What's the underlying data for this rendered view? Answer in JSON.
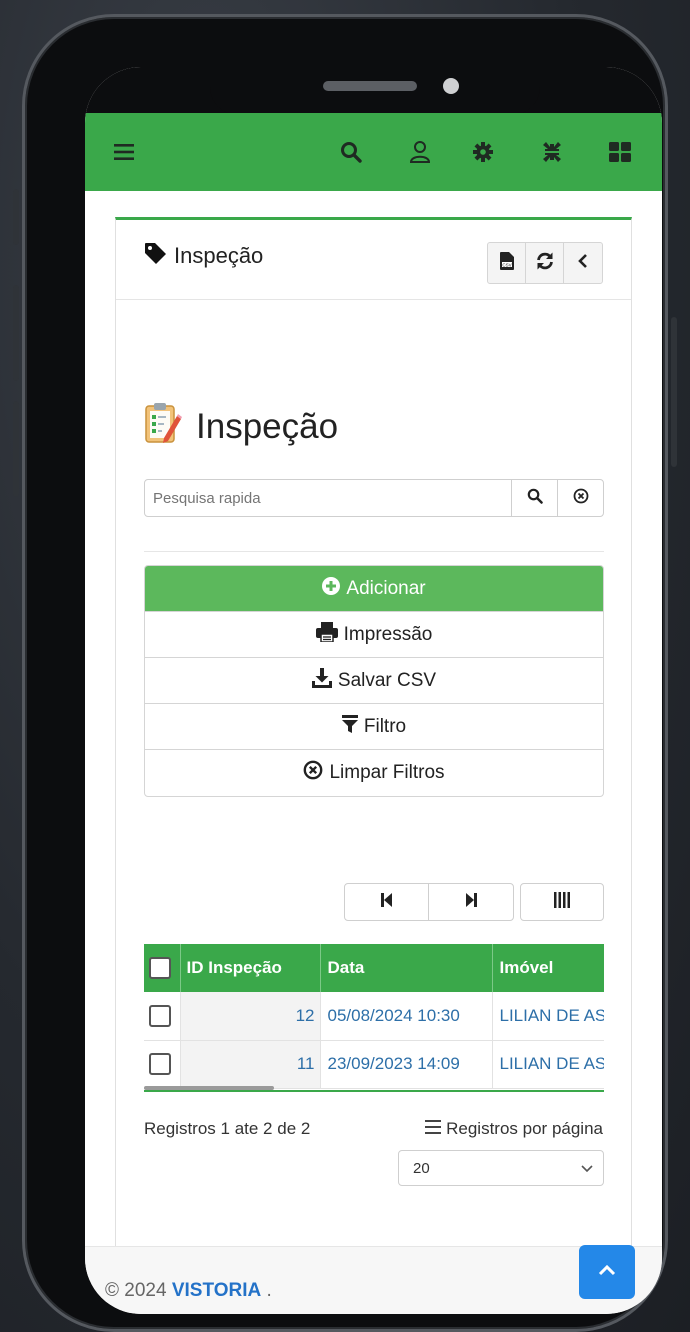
{
  "topbar": {
    "icons": [
      "menu-icon",
      "search-icon",
      "user-icon",
      "settings-icon",
      "compress-icon",
      "grid-icon"
    ]
  },
  "card": {
    "title": "Inspeção",
    "header_buttons": [
      "csv-icon",
      "refresh-icon",
      "chevron-left-icon"
    ]
  },
  "page": {
    "title": "Inspeção"
  },
  "search": {
    "placeholder": "Pesquisa rapida"
  },
  "actions": {
    "add": "Adicionar",
    "print": "Impressão",
    "save_csv": "Salvar CSV",
    "filter": "Filtro",
    "clear_filters": "Limpar Filtros"
  },
  "table": {
    "columns": [
      "ID Inspeção",
      "Data",
      "Imóvel"
    ],
    "rows": [
      {
        "id": "12",
        "data": "05/08/2024 10:30",
        "imovel": "LILIAN DE ASS"
      },
      {
        "id": "11",
        "data": "23/09/2023 14:09",
        "imovel": "LILIAN DE ASS"
      }
    ]
  },
  "pagination": {
    "info": "Registros 1 ate 2 de 2",
    "per_page_label": "Registros por página",
    "per_page_value": "20"
  },
  "footer": {
    "copyright": "© 2024",
    "brand": "VISTORIA",
    "suffix": "."
  },
  "colors": {
    "primary_green": "#3aa84a",
    "button_green": "#5cb85c",
    "link_blue": "#2d6fa8",
    "to_top_blue": "#2488e8"
  }
}
